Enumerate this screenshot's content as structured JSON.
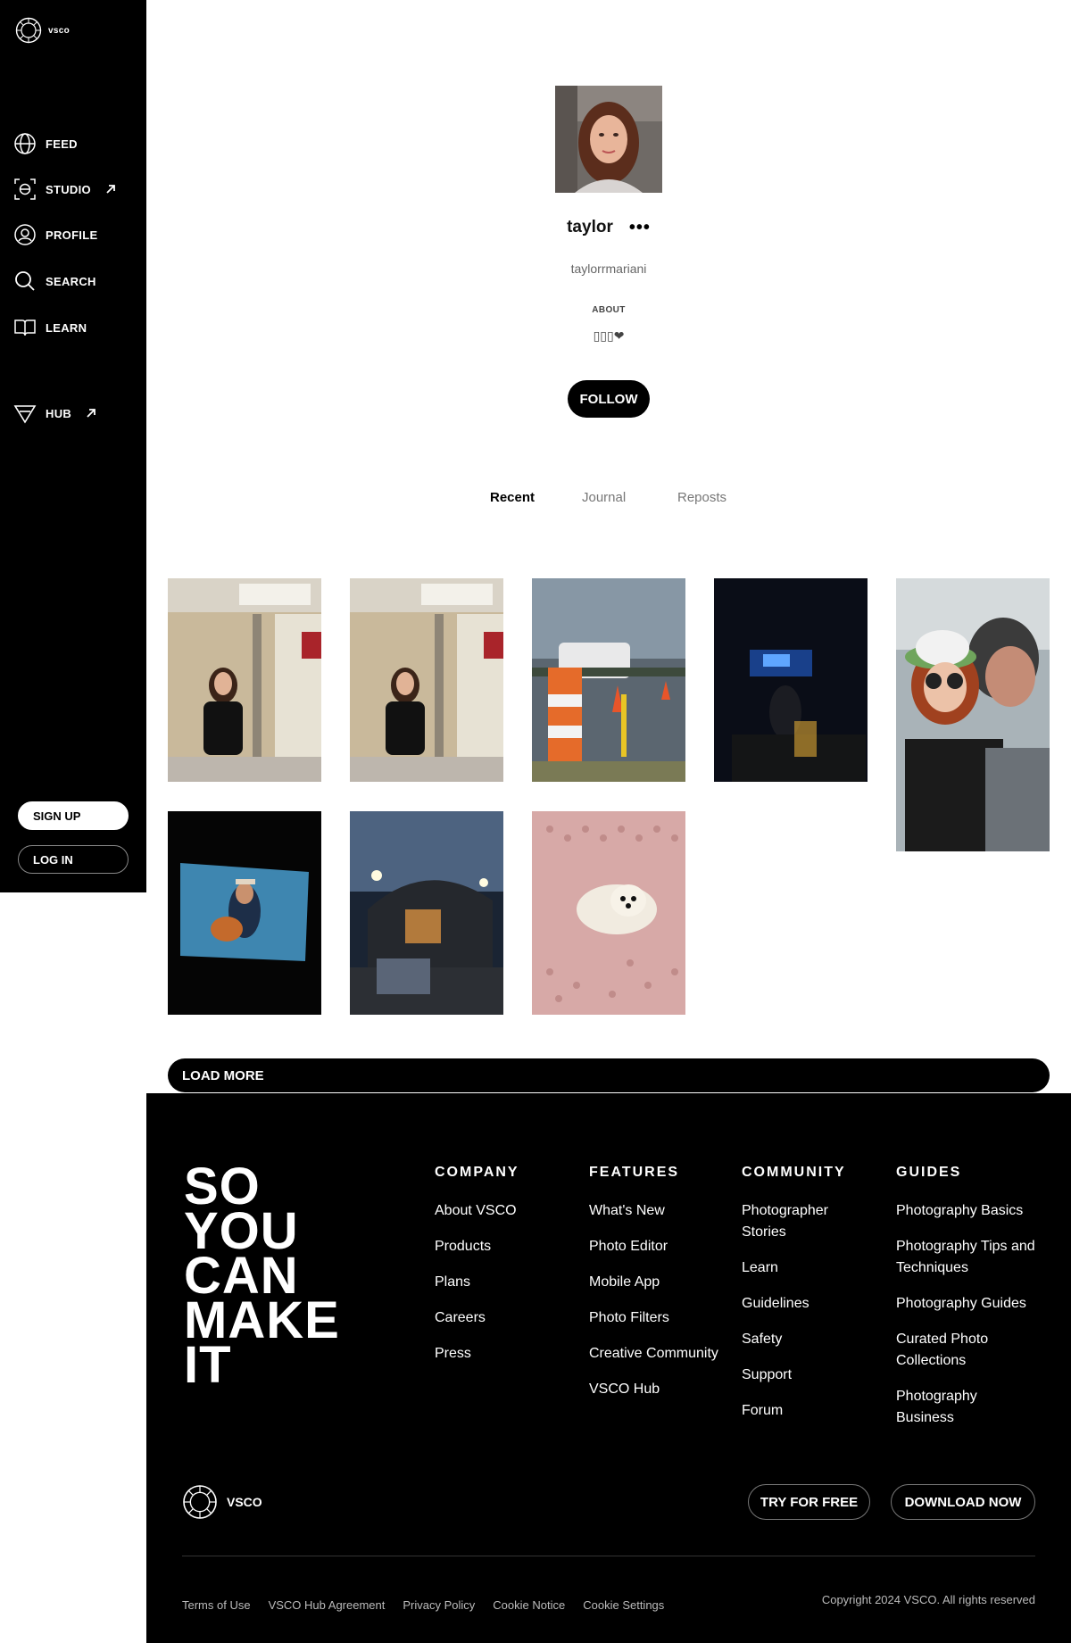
{
  "sidebar": {
    "logo_text": "vsco",
    "items": [
      {
        "label": "FEED",
        "icon": "globe-icon"
      },
      {
        "label": "STUDIO",
        "icon": "studio-icon",
        "external": true
      },
      {
        "label": "PROFILE",
        "icon": "profile-icon"
      },
      {
        "label": "SEARCH",
        "icon": "search-icon"
      },
      {
        "label": "LEARN",
        "icon": "book-icon"
      },
      {
        "label": "HUB",
        "icon": "hub-icon",
        "external": true
      }
    ],
    "signup_label": "SIGN UP",
    "login_label": "LOG IN"
  },
  "profile": {
    "name": "taylor",
    "more_label": "•••",
    "handle": "taylorrmariani",
    "about_label": "ABOUT",
    "about_text": "▯▯▯❤",
    "follow_label": "FOLLOW"
  },
  "tabs": [
    "Recent",
    "Journal",
    "Reposts"
  ],
  "active_tab": "Recent",
  "photos": [
    "mirror selfie in restroom",
    "mirror selfie in restroom",
    "parking lot with traffic cones",
    "concert stage at night",
    "selfie with man",
    "concert screen with guitarist",
    "stadium at dusk",
    "small white dog on pink blanket"
  ],
  "load_more_label": "LOAD MORE",
  "footer": {
    "slogan": "SO YOU CAN MAKE IT",
    "columns": [
      {
        "title": "COMPANY",
        "links": [
          "About VSCO",
          "Products",
          "Plans",
          "Careers",
          "Press"
        ]
      },
      {
        "title": "FEATURES",
        "links": [
          "What's New",
          "Photo Editor",
          "Mobile App",
          "Photo Filters",
          "Creative Community",
          "VSCO Hub"
        ]
      },
      {
        "title": "COMMUNITY",
        "links": [
          "Photographer Stories",
          "Learn",
          "Guidelines",
          "Safety",
          "Support",
          "Forum"
        ]
      },
      {
        "title": "GUIDES",
        "links": [
          "Photography Basics",
          "Photography Tips and Techniques",
          "Photography Guides",
          "Curated Photo Collections",
          "Photography Business"
        ]
      }
    ],
    "logo_text": "VSCO",
    "try_label": "TRY FOR FREE",
    "download_label": "DOWNLOAD NOW",
    "legal_links": [
      "Terms of Use",
      "VSCO Hub Agreement",
      "Privacy Policy",
      "Cookie Notice",
      "Cookie Settings"
    ],
    "copyright": "Copyright 2024 VSCO. All rights reserved"
  },
  "colors": {
    "sidebar_bg": "#000000",
    "footer_bg": "#000000",
    "accent": "#000000"
  }
}
